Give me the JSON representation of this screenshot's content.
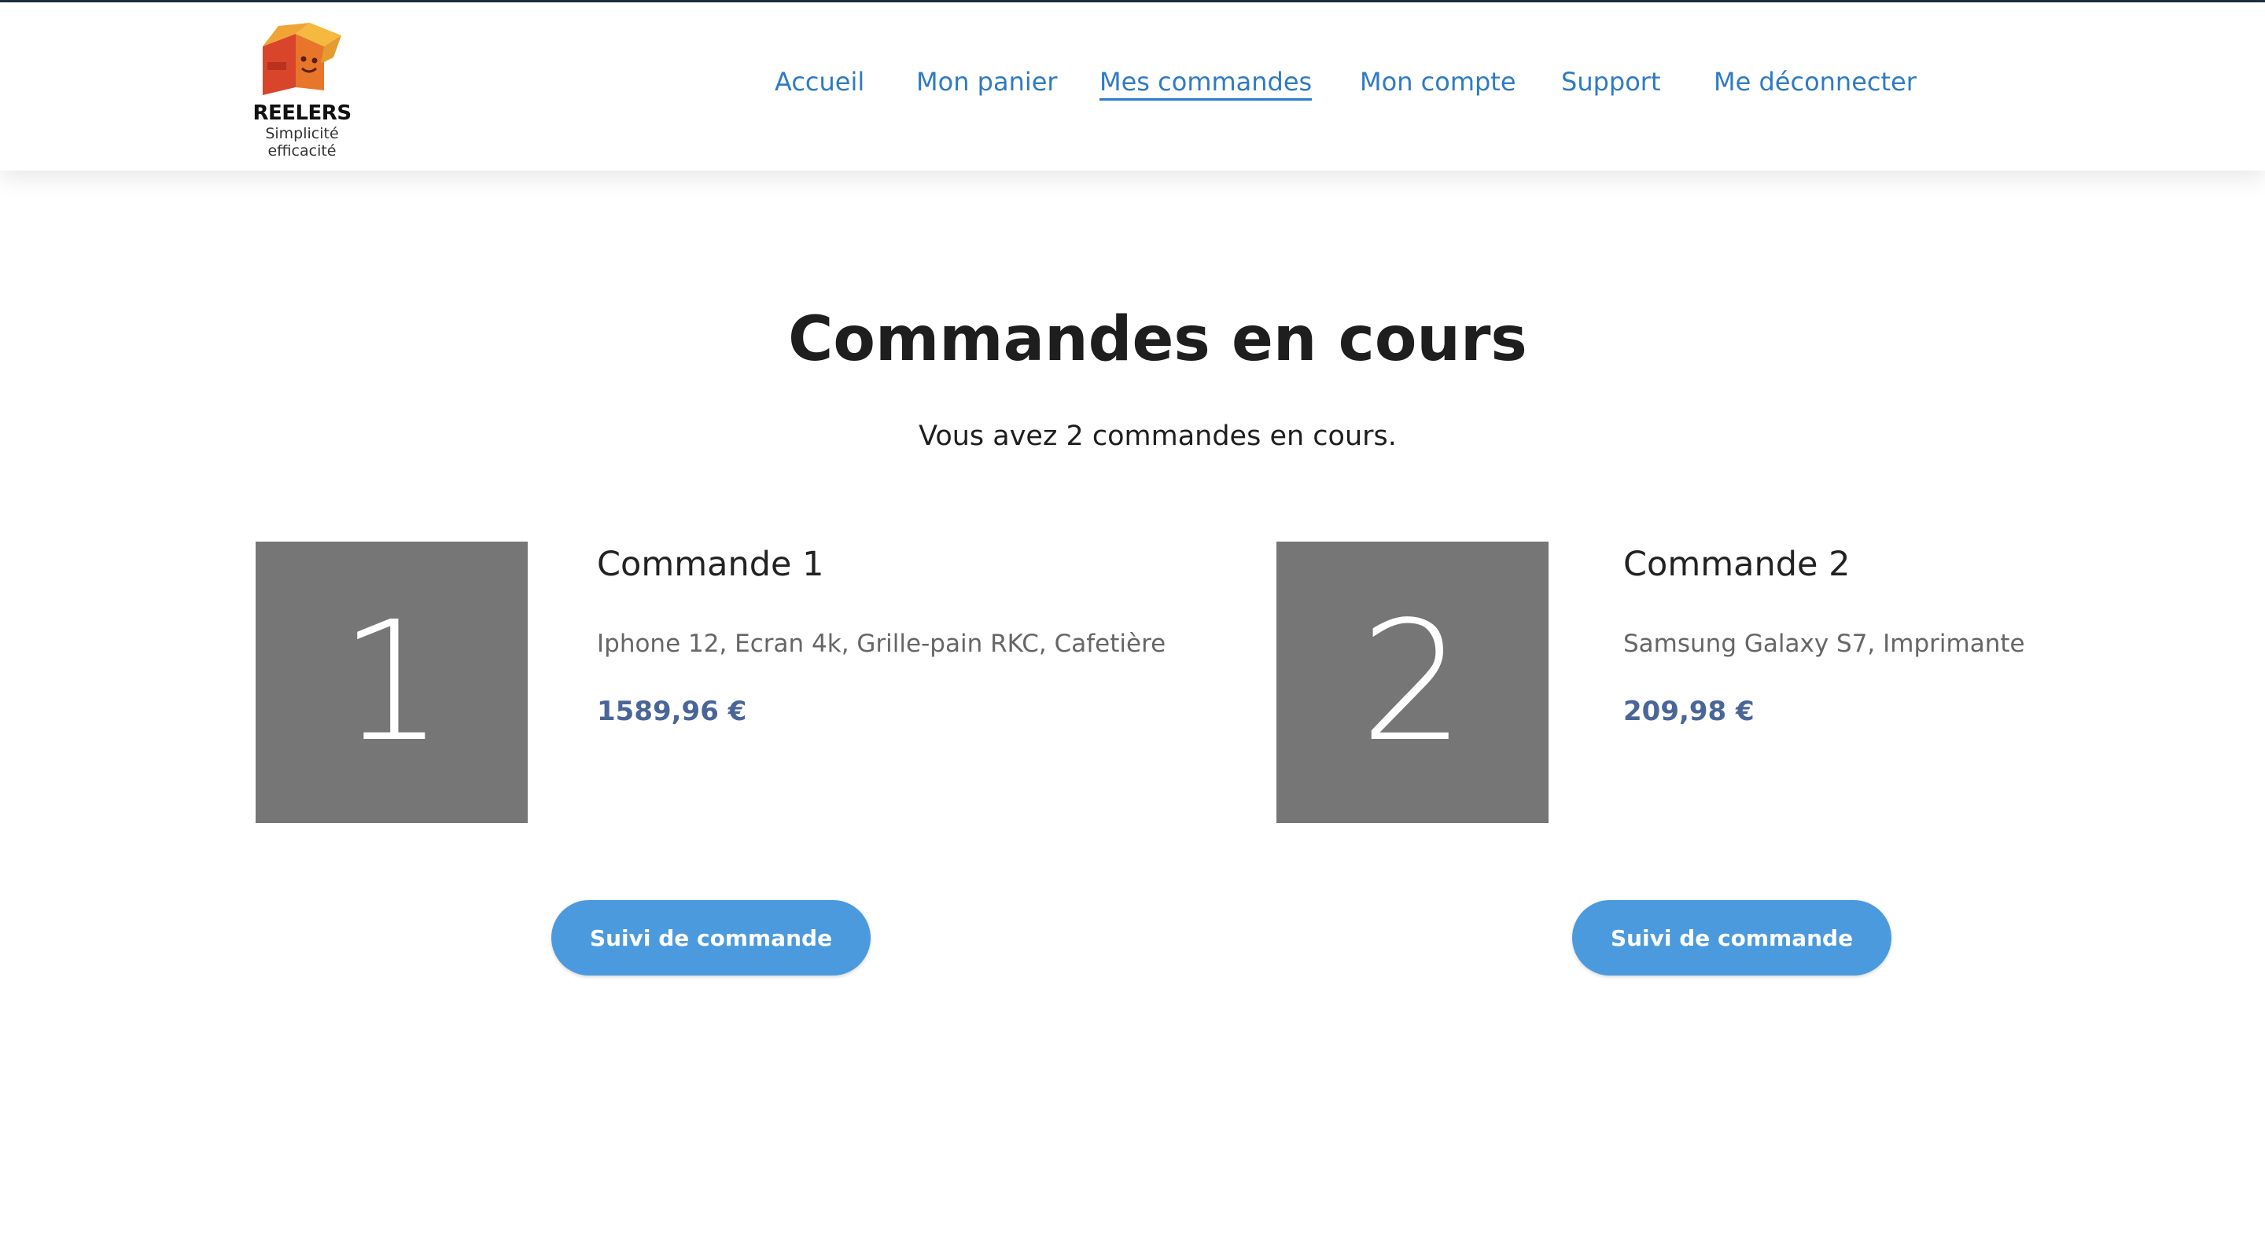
{
  "brand": {
    "name": "REELERS",
    "tagline": "Simplicité efficacité",
    "logo_icon": "open-box-logo"
  },
  "nav": {
    "items": [
      {
        "label": "Accueil",
        "active": false
      },
      {
        "label": "Mon panier",
        "active": false
      },
      {
        "label": "Mes commandes",
        "active": true
      },
      {
        "label": "Mon compte",
        "active": false
      },
      {
        "label": "Support",
        "active": false
      },
      {
        "label": "Me déconnecter",
        "active": false
      }
    ]
  },
  "main": {
    "title": "Commandes en cours",
    "subtitle": "Vous avez 2 commandes en cours.",
    "orders": [
      {
        "number": "1",
        "title": "Commande 1",
        "items": "Iphone 12, Ecran 4k, Grille-pain RKC, Cafetière",
        "price": "1589,96 €",
        "button_label": "Suivi de commande"
      },
      {
        "number": "2",
        "title": "Commande 2",
        "items": "Samsung Galaxy S7, Imprimante",
        "price": "209,98 €",
        "button_label": "Suivi de commande"
      }
    ]
  },
  "colors": {
    "link": "#2e7bc4",
    "price": "#4a6698",
    "button": "#4c9ade",
    "number_box": "#767676"
  }
}
